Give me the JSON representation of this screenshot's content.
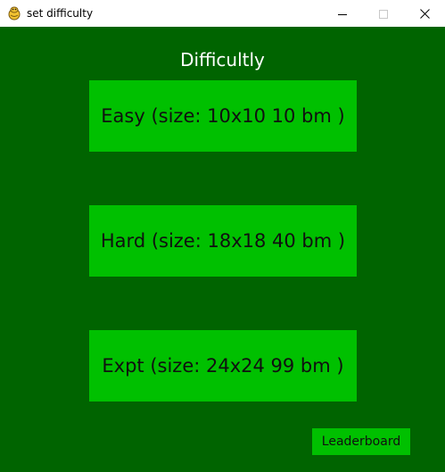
{
  "window": {
    "title": "set difficulty",
    "icon": "pygame-snake-icon",
    "controls": {
      "minimize": "minimize-icon",
      "maximize": "maximize-icon",
      "close": "close-icon"
    }
  },
  "colors": {
    "background": "#006400",
    "button": "#00c000",
    "heading_text": "#ffffff",
    "button_text": "#101010"
  },
  "main": {
    "heading": "Difficultly",
    "buttons": [
      {
        "label": "Easy (size: 10x10 10 bm )"
      },
      {
        "label": "Hard (size: 18x18 40 bm )"
      },
      {
        "label": "Expt (size: 24x24 99 bm )"
      }
    ],
    "leaderboard_label": "Leaderboard"
  }
}
